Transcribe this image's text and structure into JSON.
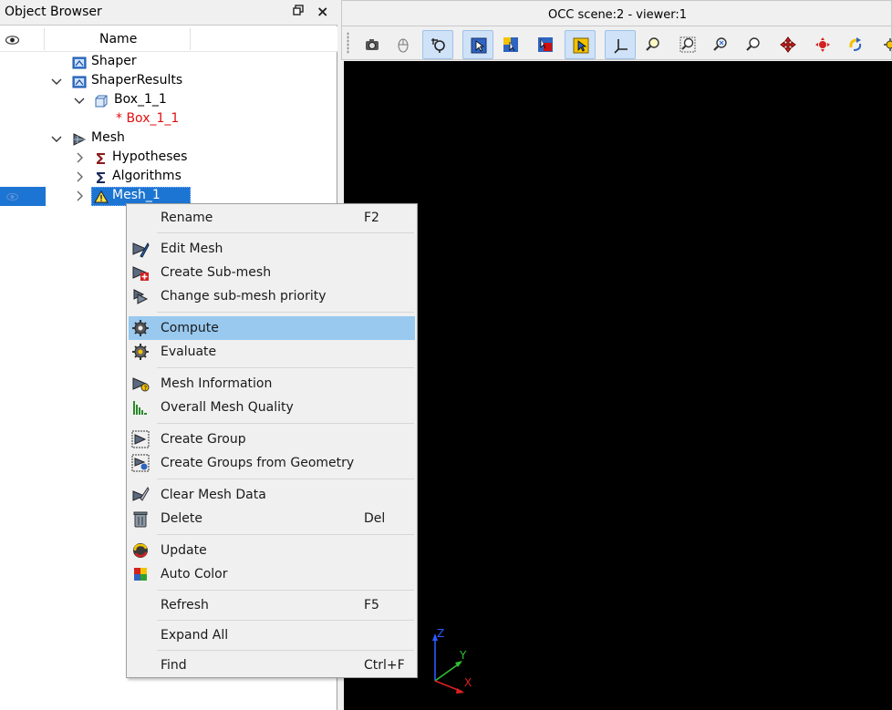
{
  "object_browser": {
    "title": "Object Browser",
    "header_name": "Name",
    "float_icon": "restore-icon",
    "close_icon": "×",
    "tree": {
      "shaper": "Shaper",
      "shaper_results": "ShaperResults",
      "box_1_1": "Box_1_1",
      "box_1_1_ref": "* Box_1_1",
      "mesh": "Mesh",
      "hypotheses": "Hypotheses",
      "algorithms": "Algorithms",
      "mesh_1": "Mesh_1"
    },
    "selection_color": "#1c75d2"
  },
  "viewer": {
    "title": "OCC scene:2 - viewer:1",
    "background": "#000000",
    "toolbar_icons": [
      "dump-view-icon",
      "mouse-mode-icon",
      "interaction-style-icon",
      "selection-rect-icon",
      "zooming-style-icon",
      "preselection-icon",
      "selection-icon",
      "show-trihedron-icon",
      "fit-all-icon",
      "fit-area-icon",
      "fit-selection-icon",
      "zoom-icon",
      "pan-icon",
      "global-pan-icon",
      "rotate-icon",
      "rotation-point-icon"
    ],
    "axes": {
      "z": "Z",
      "y": "Y",
      "x": "X"
    }
  },
  "context_menu": {
    "items": [
      {
        "label": "Rename",
        "shortcut": "F2",
        "icon": ""
      },
      {
        "label": "Edit Mesh",
        "shortcut": "",
        "icon": "edit-mesh-icon"
      },
      {
        "label": "Create Sub-mesh",
        "shortcut": "",
        "icon": "create-submesh-icon"
      },
      {
        "label": "Change sub-mesh priority",
        "shortcut": "",
        "icon": "submesh-priority-icon"
      },
      {
        "label": "Compute",
        "shortcut": "",
        "icon": "compute-icon"
      },
      {
        "label": "Evaluate",
        "shortcut": "",
        "icon": "evaluate-icon"
      },
      {
        "label": "Mesh Information",
        "shortcut": "",
        "icon": "mesh-info-icon"
      },
      {
        "label": "Overall Mesh Quality",
        "shortcut": "",
        "icon": "mesh-quality-icon"
      },
      {
        "label": "Create Group",
        "shortcut": "",
        "icon": "create-group-icon"
      },
      {
        "label": "Create Groups from Geometry",
        "shortcut": "",
        "icon": "groups-from-geometry-icon"
      },
      {
        "label": "Clear Mesh Data",
        "shortcut": "",
        "icon": "clear-mesh-icon"
      },
      {
        "label": "Delete",
        "shortcut": "Del",
        "icon": "trash-icon"
      },
      {
        "label": "Update",
        "shortcut": "",
        "icon": "update-icon"
      },
      {
        "label": "Auto Color",
        "shortcut": "",
        "icon": "auto-color-icon"
      },
      {
        "label": "Refresh",
        "shortcut": "F5",
        "icon": ""
      },
      {
        "label": "Expand All",
        "shortcut": "",
        "icon": ""
      },
      {
        "label": "Find",
        "shortcut": "Ctrl+F",
        "icon": ""
      }
    ],
    "highlighted": "Compute",
    "highlight_color": "#99c9ef"
  }
}
